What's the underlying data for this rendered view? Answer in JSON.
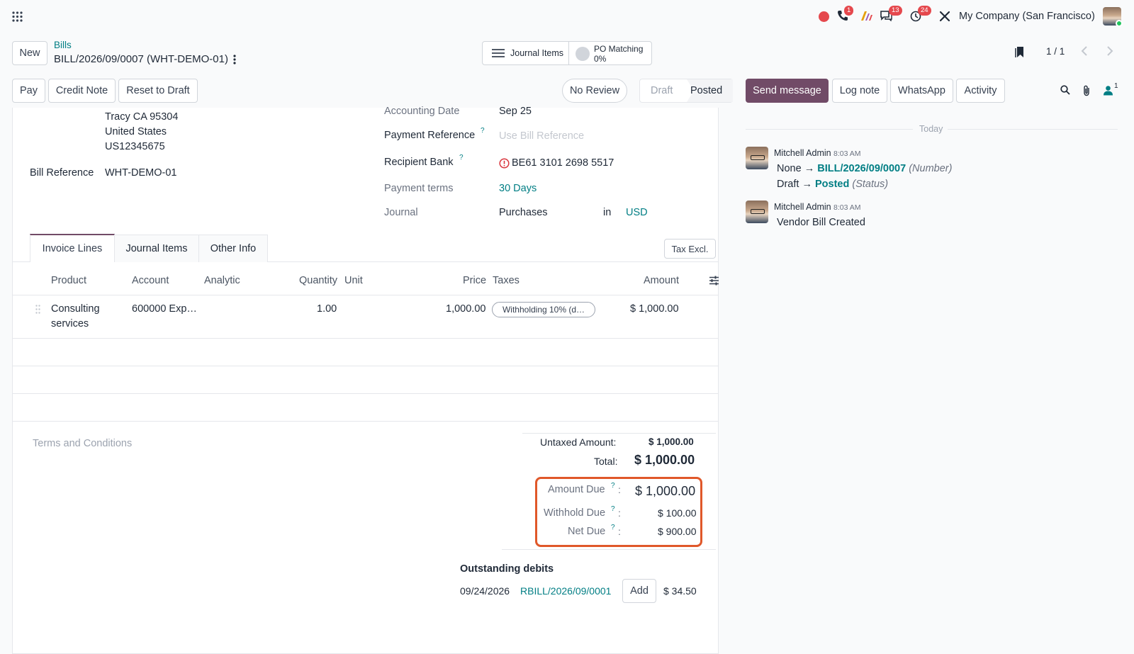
{
  "topbar": {
    "company": "My Company (San Francisco)",
    "badges": {
      "phone": "1",
      "chat": "13",
      "activity": "24"
    }
  },
  "header": {
    "new_label": "New",
    "breadcrumb": "Bills",
    "record_title": "BILL/2026/09/0007 (WHT-DEMO-01)",
    "smart_journal": "Journal Items",
    "smart_po_label": "PO Matching",
    "smart_po_value": "0%",
    "pager": "1 / 1"
  },
  "actions": {
    "pay": "Pay",
    "credit_note": "Credit Note",
    "reset": "Reset to Draft",
    "no_review": "No Review",
    "status_draft": "Draft",
    "status_posted": "Posted"
  },
  "chatter_buttons": {
    "send": "Send message",
    "log": "Log note",
    "whatsapp": "WhatsApp",
    "activity": "Activity",
    "followers": "1"
  },
  "partner": {
    "address_1": "Tracy CA 95304",
    "address_2": "United States",
    "vat": "US12345675",
    "bill_ref_label": "Bill Reference",
    "bill_ref_value": "WHT-DEMO-01"
  },
  "fields": {
    "accounting_date_label": "Accounting Date",
    "accounting_date_value": "Sep 25",
    "payment_ref_label": "Payment Reference",
    "payment_ref_placeholder": "Use Bill Reference",
    "bank_label": "Recipient Bank",
    "bank_value": "BE61 3101 2698 5517",
    "terms_label": "Payment terms",
    "terms_value": "30 Days",
    "journal_label": "Journal",
    "journal_value": "Purchases",
    "in": "in",
    "currency": "USD",
    "help": "?"
  },
  "tabs": [
    "Invoice Lines",
    "Journal Items",
    "Other Info"
  ],
  "tax_excl": "Tax Excl.",
  "table": {
    "headers": {
      "product": "Product",
      "account": "Account",
      "analytic": "Analytic",
      "quantity": "Quantity",
      "unit": "Unit",
      "price": "Price",
      "taxes": "Taxes",
      "amount": "Amount"
    },
    "rows": [
      {
        "product_1": "Consulting",
        "product_2": "services",
        "account": "600000 Exp…",
        "quantity": "1.00",
        "price": "1,000.00",
        "tax": "Withholding 10% (d…",
        "amount": "$ 1,000.00"
      }
    ]
  },
  "terms_placeholder": "Terms and Conditions",
  "totals": {
    "untaxed_label": "Untaxed Amount:",
    "untaxed_value": "$ 1,000.00",
    "total_label": "Total:",
    "total_value": "$ 1,000.00",
    "amount_due_label": "Amount Due",
    "amount_due_value": "$ 1,000.00",
    "withhold_label": "Withhold Due",
    "withhold_value": "$ 100.00",
    "net_label": "Net Due",
    "net_value": "$ 900.00",
    "colon": ":"
  },
  "outstanding": {
    "title": "Outstanding debits",
    "date": "09/24/2026",
    "ref": "RBILL/2026/09/0001",
    "add": "Add",
    "amount": "$ 34.50"
  },
  "chatter": {
    "today": "Today",
    "messages": [
      {
        "author": "Mitchell Admin",
        "time": "8:03 AM",
        "line1_old": "None",
        "line1_new": "BILL/2026/09/0007",
        "line1_field": "(Number)",
        "line2_old": "Draft",
        "line2_new": "Posted",
        "line2_field": "(Status)",
        "arrow": "→"
      },
      {
        "author": "Mitchell Admin",
        "time": "8:03 AM",
        "body": "Vendor Bill Created"
      }
    ]
  },
  "colors": {
    "primary": "#714b67",
    "link": "#017e84",
    "highlight": "#e0582a",
    "badge": "#e5484d"
  }
}
